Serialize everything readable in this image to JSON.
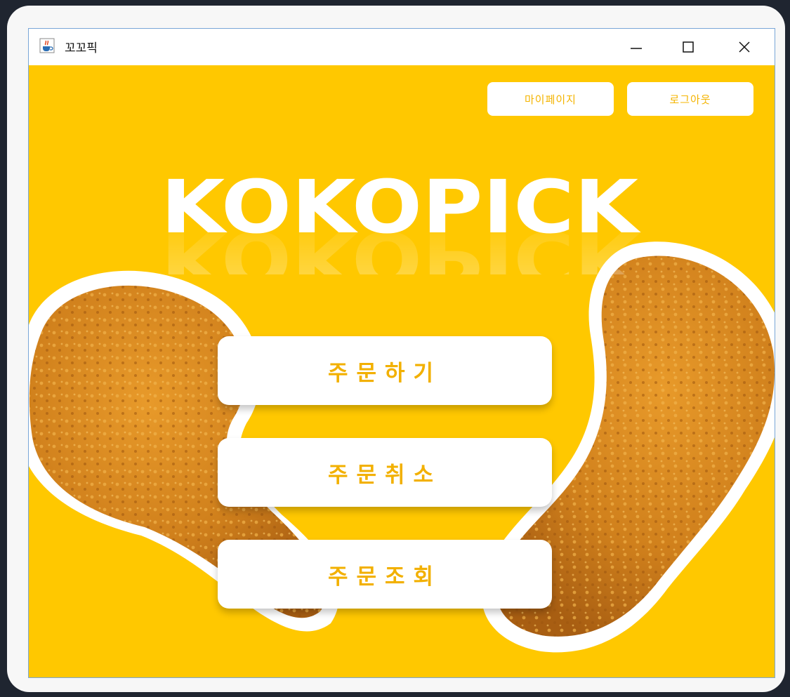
{
  "window": {
    "title": "꼬꼬픽",
    "app_icon": "java-cup-icon",
    "controls": [
      "minimize-icon",
      "maximize-icon",
      "close-icon"
    ]
  },
  "header": {
    "mypage_label": "마이페이지",
    "logout_label": "로그아웃"
  },
  "brand": {
    "logo_text": "KOKOPICK"
  },
  "menu": {
    "order_label": "주문하기",
    "cancel_label": "주문취소",
    "lookup_label": "주문조회"
  },
  "colors": {
    "background": "#ffc800",
    "button_text": "#f2b000",
    "button_bg": "#ffffff",
    "chicken": "#d98a1e"
  }
}
